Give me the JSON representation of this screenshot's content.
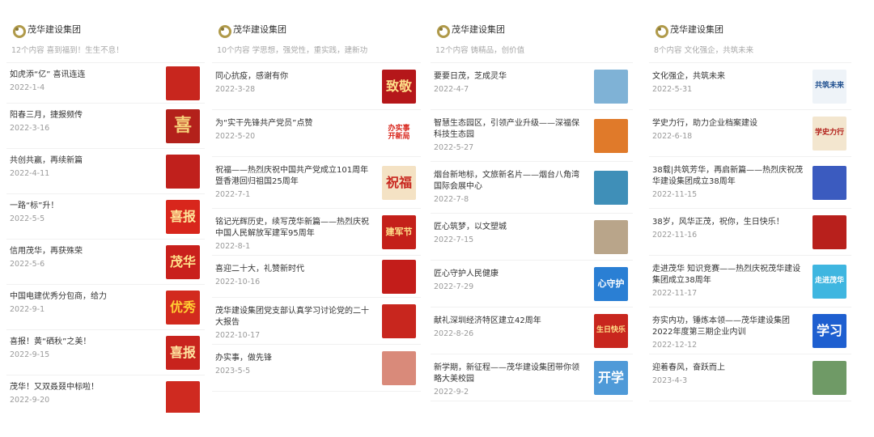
{
  "columns": [
    {
      "brand": "茂华建设集团",
      "subtitle": "12个内容  喜到福到！生生不息！",
      "items": [
        {
          "title": "如虎添“亿”  喜讯连连",
          "date": "2022-1-4",
          "thumb_text": "",
          "thumb_color": "#c8261e",
          "thumb_fg": "#ffdd66"
        },
        {
          "title": "阳春三月，捷报频传",
          "date": "2022-3-16",
          "thumb_text": "喜",
          "thumb_color": "#b3211b",
          "thumb_fg": "#f6d27a"
        },
        {
          "title": "共创共赢，再续新篇",
          "date": "2022-4-11",
          "thumb_text": "",
          "thumb_color": "#c0201c",
          "thumb_fg": "#ffe08a"
        },
        {
          "title": "一路“标”升！",
          "date": "2022-5-5",
          "thumb_text": "喜报",
          "thumb_color": "#d8261c",
          "thumb_fg": "#ffe69a"
        },
        {
          "title": "信用茂华，再获殊荣",
          "date": "2022-5-6",
          "thumb_text": "茂华",
          "thumb_color": "#c9201c",
          "thumb_fg": "#ffe08a"
        },
        {
          "title": "中国电建优秀分包商，给力",
          "date": "2022-9-1",
          "thumb_text": "优秀",
          "thumb_color": "#d22a1e",
          "thumb_fg": "#ffcc33"
        },
        {
          "title": "喜报！黄“硒秋”之美！",
          "date": "2022-9-15",
          "thumb_text": "喜报",
          "thumb_color": "#c8231d",
          "thumb_fg": "#ffe5a0"
        },
        {
          "title": "茂华！又双叒叕中标啦！",
          "date": "2022-9-20",
          "thumb_text": "",
          "thumb_color": "#cf2a20",
          "thumb_fg": "#ffe08a"
        }
      ]
    },
    {
      "brand": "茂华建设集团",
      "subtitle": "10个内容  学思想，强党性，重实践，建新功",
      "items": [
        {
          "title": "同心抗疫，感谢有你",
          "date": "2022-3-28",
          "thumb_text": "致敬",
          "thumb_color": "#b5171a",
          "thumb_fg": "#ffe08a"
        },
        {
          "title": "为“实干先锋共产党员”点赞",
          "date": "2022-5-20",
          "thumb_text": "办实事\n开新局",
          "thumb_color": "#ffffff",
          "thumb_fg": "#d8261c"
        },
        {
          "title": "祝福——热烈庆祝中国共产党成立101周年暨香港回归祖国25周年",
          "date": "2022-7-1",
          "thumb_text": "祝福",
          "thumb_color": "#f4e2c4",
          "thumb_fg": "#c8261e"
        },
        {
          "title": "铭记光辉历史，续写茂华新篇——热烈庆祝中国人民解放军建军95周年",
          "date": "2022-8-1",
          "thumb_text": "建军节",
          "thumb_color": "#c4201a",
          "thumb_fg": "#ffe08a"
        },
        {
          "title": "喜迎二十大，礼赞新时代",
          "date": "2022-10-16",
          "thumb_text": "",
          "thumb_color": "#c31d1a",
          "thumb_fg": "#ffe08a"
        },
        {
          "title": "茂华建设集团党支部认真学习讨论党的二十大报告",
          "date": "2022-10-17",
          "thumb_text": "",
          "thumb_color": "#c8261e",
          "thumb_fg": "#ffe08a"
        },
        {
          "title": "办实事，做先锋",
          "date": "2023-5-5",
          "thumb_text": "",
          "thumb_color": "#d98a7a",
          "thumb_fg": "#ffffff"
        }
      ]
    },
    {
      "brand": "茂华建设集团",
      "subtitle": "12个内容  铸精品，创价值",
      "items": [
        {
          "title": "要要日茂，芝成灵华",
          "date": "2022-4-7",
          "thumb_text": "",
          "thumb_color": "#7fb2d6",
          "thumb_fg": "#ffffff"
        },
        {
          "title": "智慧生态园区，引领产业升级——深福保科技生态园",
          "date": "2022-5-27",
          "thumb_text": "",
          "thumb_color": "#e07a2a",
          "thumb_fg": "#ffffff"
        },
        {
          "title": "烟台新地标，文旅新名片——烟台八角湾国际会展中心",
          "date": "2022-7-8",
          "thumb_text": "",
          "thumb_color": "#3f8fb8",
          "thumb_fg": "#ffffff"
        },
        {
          "title": "匠心筑梦，以文塑城",
          "date": "2022-7-15",
          "thumb_text": "",
          "thumb_color": "#b9a58a",
          "thumb_fg": "#ffffff"
        },
        {
          "title": "匠心守护人民健康",
          "date": "2022-7-29",
          "thumb_text": "心守护",
          "thumb_color": "#2a7fd4",
          "thumb_fg": "#ffffff"
        },
        {
          "title": "献礼深圳经济特区建立42周年",
          "date": "2022-8-26",
          "thumb_text": "生日快乐",
          "thumb_color": "#c8261e",
          "thumb_fg": "#ffe08a"
        },
        {
          "title": "新学期，新征程——茂华建设集团带你领略大美校园",
          "date": "2022-9-2",
          "thumb_text": "开学",
          "thumb_color": "#4f9ad8",
          "thumb_fg": "#ffffff"
        }
      ]
    },
    {
      "brand": "茂华建设集团",
      "subtitle": "8个内容  文化强企，共筑未来",
      "items": [
        {
          "title": "文化强企，共筑未来",
          "date": "2022-5-31",
          "thumb_text": "共筑未来",
          "thumb_color": "#eef3f8",
          "thumb_fg": "#1f4f8f"
        },
        {
          "title": "学史力行，助力企业档案建设",
          "date": "2022-6-18",
          "thumb_text": "学史力行",
          "thumb_color": "#f3e6cf",
          "thumb_fg": "#b3211b"
        },
        {
          "title": "38载|共筑芳华，再启新篇——热烈庆祝茂华建设集团成立38周年",
          "date": "2022-11-15",
          "thumb_text": "",
          "thumb_color": "#3b5bbf",
          "thumb_fg": "#ffffff"
        },
        {
          "title": "38岁，风华正茂，祝你，生日快乐！",
          "date": "2022-11-16",
          "thumb_text": "",
          "thumb_color": "#b8201c",
          "thumb_fg": "#ffe08a"
        },
        {
          "title": "走进茂华 知识竞赛——热烈庆祝茂华建设集团成立38周年",
          "date": "2022-11-17",
          "thumb_text": "走进茂华",
          "thumb_color": "#3fb6e0",
          "thumb_fg": "#ffffff"
        },
        {
          "title": "夯实内功，锤炼本领——茂华建设集团2022年度第三期企业内训",
          "date": "2022-12-12",
          "thumb_text": "学习",
          "thumb_color": "#1e5fd0",
          "thumb_fg": "#ffffff"
        },
        {
          "title": "迎着春风，奋跃而上",
          "date": "2023-4-3",
          "thumb_text": "",
          "thumb_color": "#6f9a66",
          "thumb_fg": "#ffffff"
        }
      ]
    }
  ]
}
